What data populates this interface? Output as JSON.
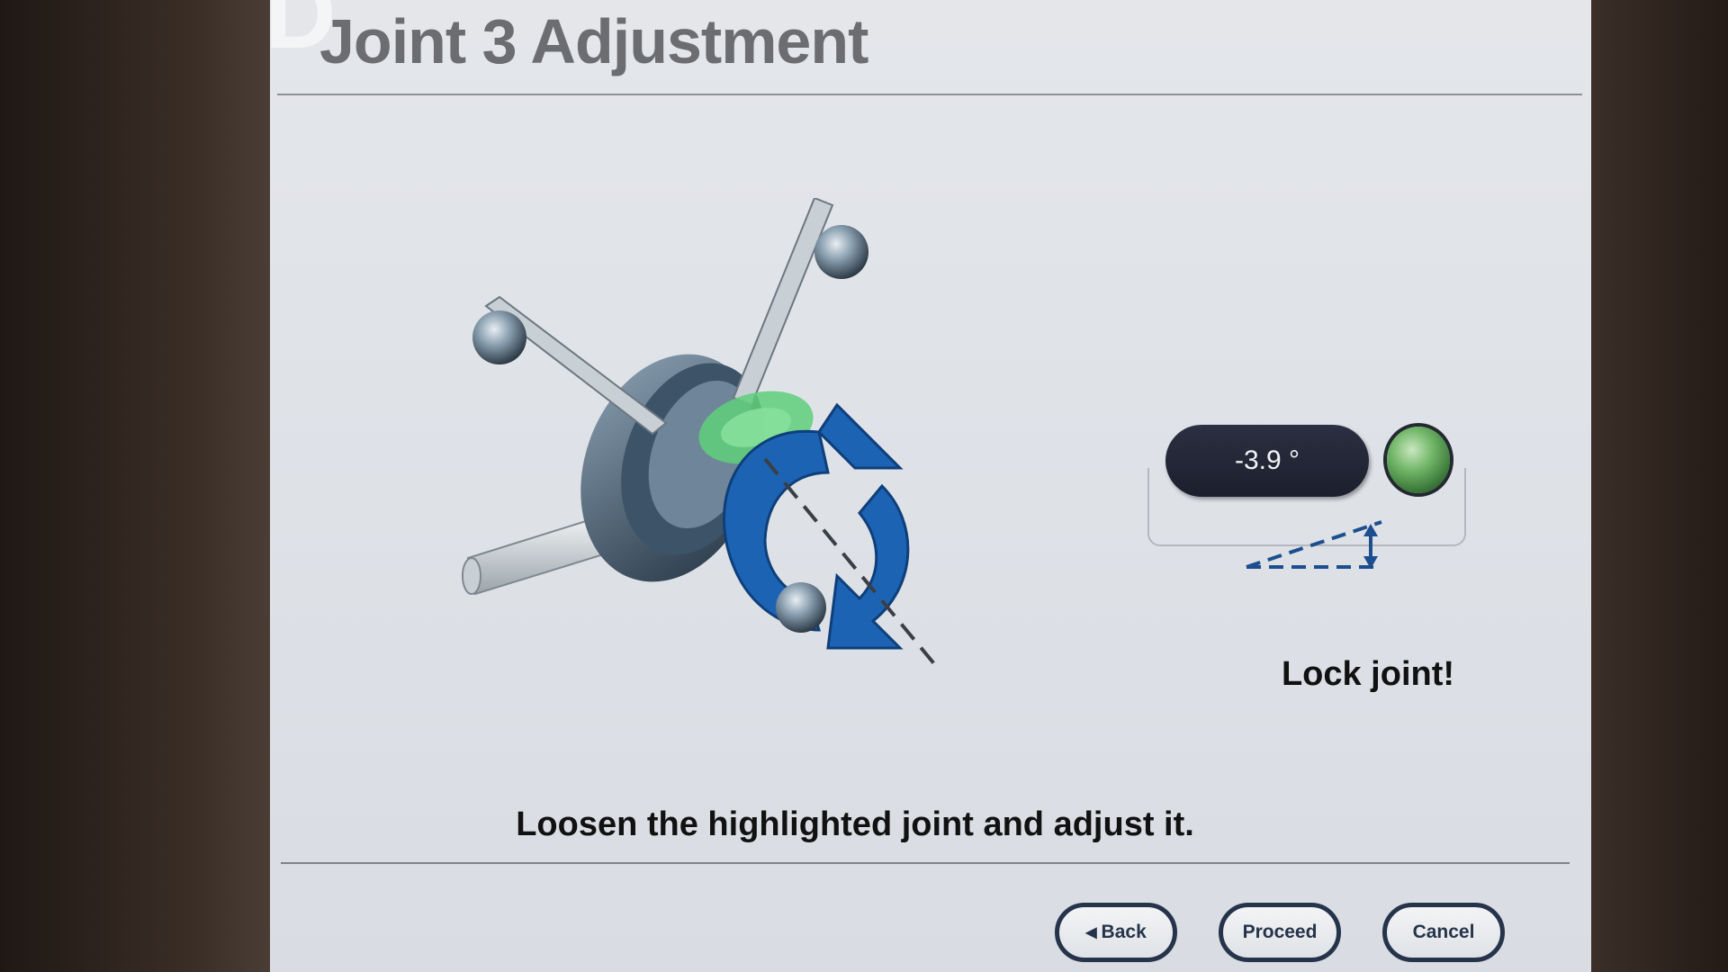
{
  "screen": {
    "step_letter": "D",
    "title": "Joint 3 Adjustment"
  },
  "readout": {
    "angle_value": "-3.9 °",
    "status_color": "#5aa852",
    "status_label": "Lock joint!"
  },
  "instruction": "Loosen the highlighted joint and adjust it.",
  "buttons": {
    "back": "Back",
    "proceed": "Proceed",
    "cancel": "Cancel"
  },
  "colors": {
    "accent_blue": "#1d63b3",
    "highlight_green": "#5fcf7a",
    "button_border": "#26344b"
  },
  "icons": {
    "joint": "joint-illustration",
    "rotation": "rotation-arrows-icon",
    "angle": "angle-icon"
  }
}
